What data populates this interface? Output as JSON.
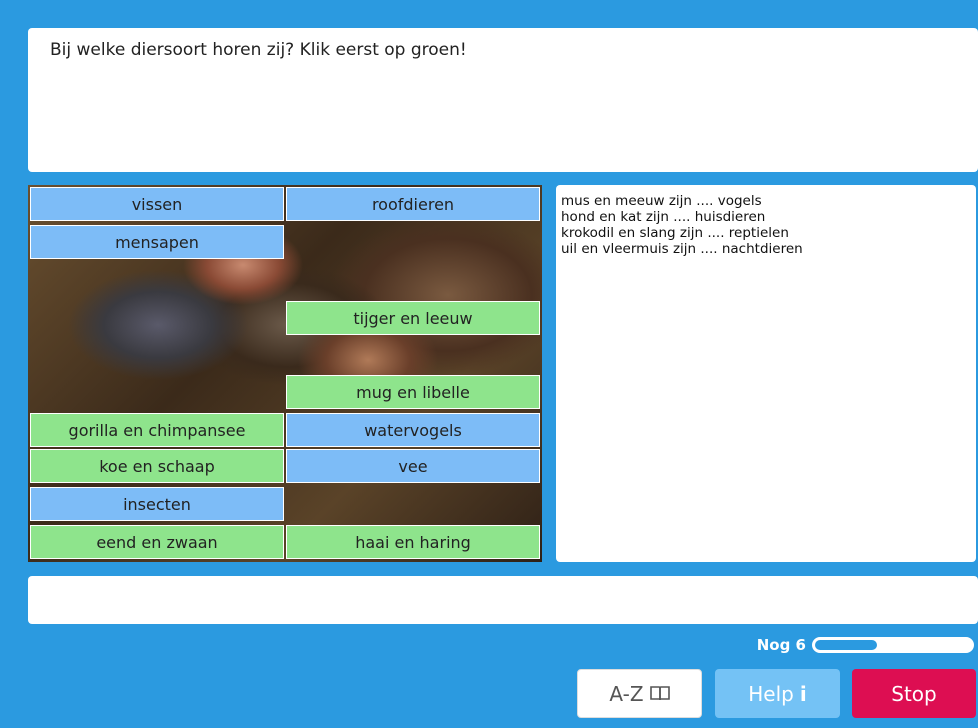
{
  "question": {
    "text": "Bij welke diersoort horen zij? Klik eerst op groen!"
  },
  "tiles": [
    {
      "label": "vissen",
      "color": "blue"
    },
    {
      "label": "roofdieren",
      "color": "blue"
    },
    {
      "label": "mensapen",
      "color": "blue"
    },
    {
      "label": "tijger en leeuw",
      "color": "green"
    },
    {
      "label": "mug en libelle",
      "color": "green"
    },
    {
      "label": "gorilla en chimpansee",
      "color": "green"
    },
    {
      "label": "watervogels",
      "color": "blue"
    },
    {
      "label": "koe en schaap",
      "color": "green"
    },
    {
      "label": "vee",
      "color": "blue"
    },
    {
      "label": "insecten",
      "color": "blue"
    },
    {
      "label": "eend en zwaan",
      "color": "green"
    },
    {
      "label": "haai en haring",
      "color": "green"
    }
  ],
  "answers": [
    "mus en meeuw zijn .... vogels",
    "hond en kat zijn .... huisdieren",
    "krokodil en slang zijn .... reptielen",
    "uil en vleermuis zijn .... nachtdieren"
  ],
  "progress": {
    "label": "Nog 6",
    "fraction": 0.4
  },
  "buttons": {
    "az_label": "A-Z",
    "az_icon": "book-icon",
    "help_label": "Help",
    "help_icon": "info-icon",
    "stop_label": "Stop"
  },
  "colors": {
    "background": "#2b9ae0",
    "tile_blue": "#7dbcf7",
    "tile_green": "#8ee48c",
    "stop": "#dd0e52",
    "help": "#74c2f5"
  }
}
